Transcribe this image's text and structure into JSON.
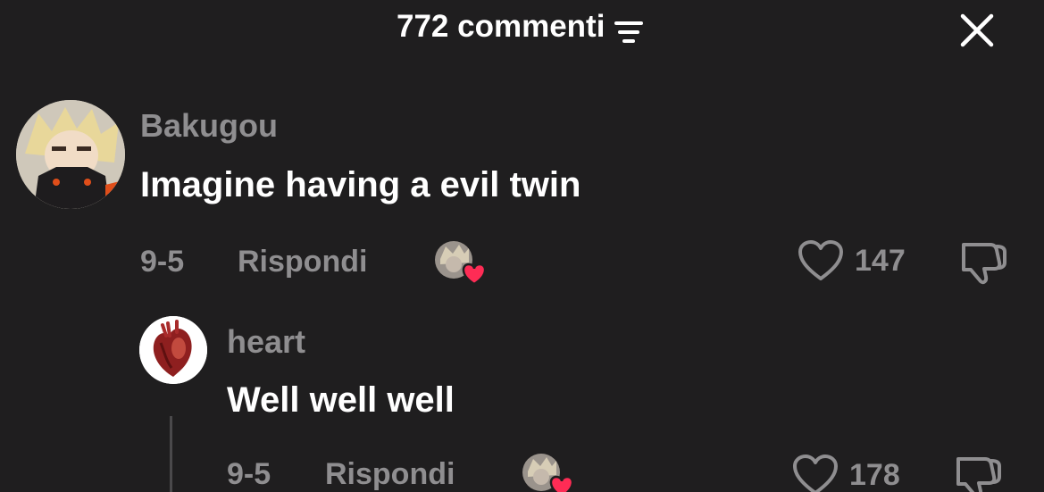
{
  "header": {
    "title": "772 commenti",
    "sort_icon": "sort-lines-icon",
    "close_icon": "close-x-icon"
  },
  "comments": [
    {
      "username": "Bakugou",
      "text": "Imagine having a evil twin",
      "date": "9-5",
      "reply_label": "Rispondi",
      "likes": "147"
    },
    {
      "username": "heart",
      "text": "Well well well",
      "date": "9-5",
      "reply_label": "Rispondi",
      "likes": "178"
    }
  ],
  "colors": {
    "background": "#1f1e1f",
    "muted_text": "#8f8e90",
    "heart_badge": "#fe2c55"
  }
}
